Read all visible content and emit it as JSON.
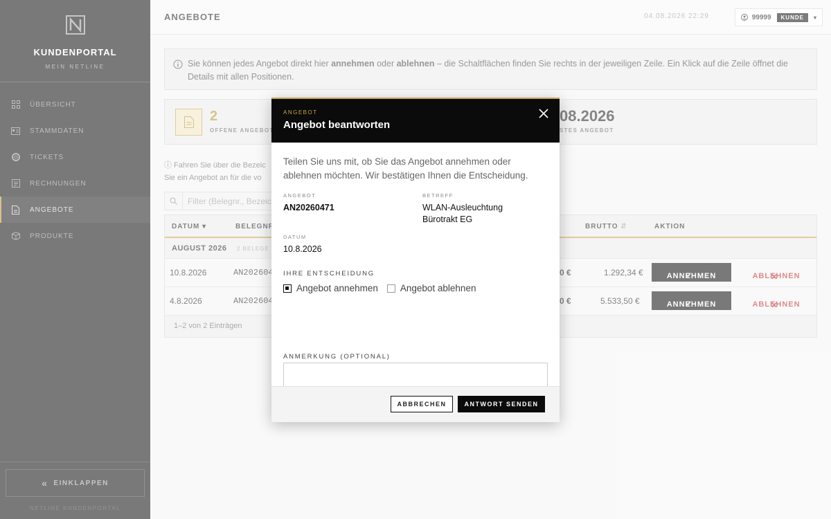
{
  "sidebar": {
    "brand_title": "KUNDENPORTAL",
    "brand_sub": "MEIN NETLINE",
    "items": [
      {
        "label": "ÜBERSICHT",
        "icon": "grid-icon"
      },
      {
        "label": "STAMMDATEN",
        "icon": "id-card-icon"
      },
      {
        "label": "TICKETS",
        "icon": "lifebuoy-icon"
      },
      {
        "label": "RECHNUNGEN",
        "icon": "invoice-icon"
      },
      {
        "label": "ANGEBOTE",
        "icon": "document-icon",
        "active": true
      },
      {
        "label": "PRODUKTE",
        "icon": "box-icon"
      }
    ],
    "collapse_label": "EINKLAPPEN",
    "footer": "NETLINE KUNDENPORTAL"
  },
  "header": {
    "title": "ANGEBOTE",
    "datetime": "04.08.2026 22:29",
    "customer_number": "99999",
    "role_badge": "KUNDE"
  },
  "info": {
    "part1": "Sie können jedes Angebot direkt hier ",
    "bold1": "annehmen",
    "part2": " oder ",
    "bold2": "ablehnen",
    "part3": " – die Schaltflächen finden Sie rechts in der jeweiligen Zeile. Ein Klick auf die Zeile öffnet die Details mit allen Positionen."
  },
  "stats": {
    "open_count": "2",
    "open_label": "OFFENE ANGEBOTE",
    "next_date": "08.2026",
    "next_label": "STES ANGEBOT"
  },
  "hint": {
    "line1": "ⓘ Fahren Sie über die Bezeic",
    "line2": "Sie ein Angebot an für die vo"
  },
  "filter": {
    "placeholder": "Filter (Belegnr., Bezeich"
  },
  "table": {
    "headers": {
      "datum": "DATUM",
      "belegnr": "BELEGNR",
      "brutto": "BRUTTO",
      "aktion": "AKTION"
    },
    "group": {
      "label": "AUGUST 2026",
      "count": "2 BELEGE"
    },
    "rows": [
      {
        "datum": "10.8.2026",
        "belegnr": "AN202604",
        "netto": "0 €",
        "brutto": "1.292,34 €"
      },
      {
        "datum": "4.8.2026",
        "belegnr": "AN202604",
        "netto": "0 €",
        "brutto": "5.533,50 €"
      }
    ],
    "accept_label": "ANNEHMEN",
    "reject_label": "ABLEHNEN",
    "footer": "1–2 von 2 Einträgen"
  },
  "modal": {
    "kicker": "ANGEBOT",
    "title": "Angebot beantworten",
    "intro": "Teilen Sie uns mit, ob Sie das Angebot annehmen oder ablehnen möchten. Wir bestätigen Ihnen die Entscheidung.",
    "angebot_label": "ANGEBOT",
    "angebot_value": "AN20260471",
    "betreff_label": "BETREFF",
    "betreff_value": "WLAN-Ausleuchtung Bürotrakt EG",
    "datum_label": "DATUM",
    "datum_value": "10.8.2026",
    "decision_label": "IHRE ENTSCHEIDUNG",
    "option_accept": "Angebot annehmen",
    "option_reject": "Angebot ablehnen",
    "selected": "accept",
    "comment_label": "ANMERKUNG (OPTIONAL)",
    "comment_value": "",
    "cancel_label": "ABBRECHEN",
    "send_label": "ANTWORT SENDEN"
  },
  "colors": {
    "accent": "#c9a44a",
    "danger": "#c62828",
    "dark": "#0b0b0b"
  }
}
